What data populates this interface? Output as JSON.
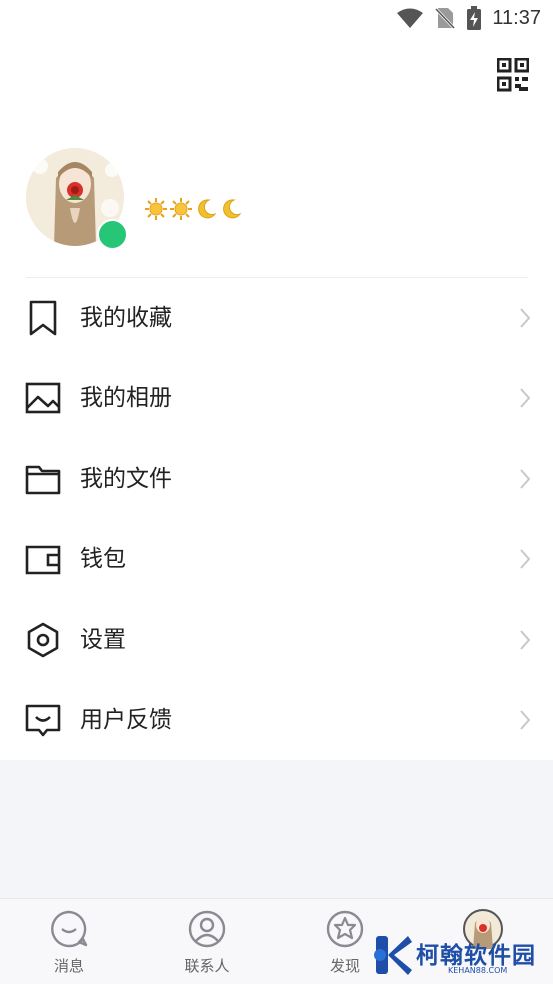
{
  "status_bar": {
    "time": "11:37",
    "icons": [
      "wifi-icon",
      "no-sim-icon",
      "battery-charging-icon"
    ]
  },
  "header": {
    "qr_icon": "qr-code-icon"
  },
  "profile": {
    "avatar": "avatar-image",
    "online_status_color": "#27c676",
    "level_badges": [
      "sun-icon",
      "sun-icon",
      "moon-icon",
      "moon-icon"
    ]
  },
  "menu": {
    "items": [
      {
        "label": "我的收藏",
        "icon": "bookmark-icon"
      },
      {
        "label": "我的相册",
        "icon": "image-icon"
      },
      {
        "label": "我的文件",
        "icon": "folder-icon"
      },
      {
        "label": "钱包",
        "icon": "wallet-icon"
      },
      {
        "label": "设置",
        "icon": "settings-icon"
      },
      {
        "label": "用户反馈",
        "icon": "feedback-icon"
      }
    ]
  },
  "tab_bar": {
    "tabs": [
      {
        "label": "消息",
        "icon": "message-icon"
      },
      {
        "label": "联系人",
        "icon": "contacts-icon"
      },
      {
        "label": "发现",
        "icon": "discover-icon"
      },
      {
        "label": "",
        "icon": "avatar-icon"
      }
    ]
  },
  "watermark": {
    "text": "柯翰软件园",
    "sub": "KEHAN88.COM"
  },
  "colors": {
    "accent_green": "#27c676",
    "icon_stroke": "#222222",
    "chevron": "#c8c8c8",
    "watermark_blue": "#1f4ea8"
  }
}
